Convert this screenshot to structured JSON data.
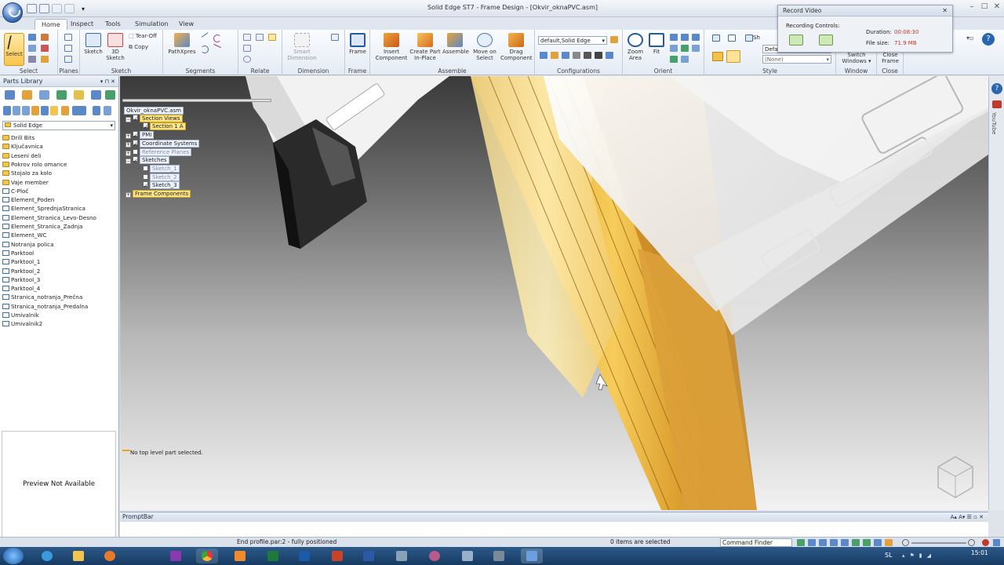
{
  "window": {
    "title": "Solid Edge ST7 - Frame Design - [Okvir_oknaPVC.asm]",
    "min": "–",
    "max": "□",
    "close": "✕"
  },
  "tabs": [
    "Home",
    "Inspect",
    "Tools",
    "Simulation",
    "View"
  ],
  "ribbon": {
    "groups": {
      "select": "Select",
      "planes": "Planes",
      "sketch": "Sketch",
      "segments": "Segments",
      "relate": "Relate",
      "dimension": "Dimension",
      "frame": "Frame",
      "assemble": "Assemble",
      "configurations": "Configurations",
      "orient": "Orient",
      "style": "Style",
      "window": "Window",
      "close": "Close"
    },
    "buttons": {
      "select": "Select",
      "sketch": "Sketch",
      "sketch3d_1": "3D",
      "sketch3d_2": "Sketch",
      "tearoff": "Tear-Off",
      "copy": "Copy",
      "pathxpres": "PathXpres",
      "smart_dim_1": "Smart",
      "smart_dim_2": "Dimension",
      "frame": "Frame",
      "insert_1": "Insert",
      "insert_2": "Component",
      "create_1": "Create Part",
      "create_2": "In-Place",
      "assemble": "Assemble",
      "move_1": "Move on",
      "move_2": "Select",
      "drag_1": "Drag",
      "drag_2": "Component",
      "zoom_1": "Zoom",
      "zoom_2": "Area",
      "fit": "Fit",
      "switch_1": "Switch",
      "switch_2": "Windows ▾",
      "closeframe_1": "Close",
      "closeframe_2": "Frame"
    },
    "configurations_value": "default,Solid Edge",
    "style_value": "(None)",
    "style_top": "Defa",
    "style_sh": "Sh"
  },
  "record_video": {
    "title": "Record Video",
    "recording_label": "Recording Controls:",
    "duration_label": "Duration:",
    "duration_value": "00:08:30",
    "filesize_label": "File size:",
    "filesize_value": "71.9 MB",
    "close": "✕"
  },
  "parts_library": {
    "title": "Parts Library",
    "location": "Solid Edge",
    "items": [
      {
        "name": "Drill Bits",
        "type": "folder"
      },
      {
        "name": "Ključavnica",
        "type": "folder"
      },
      {
        "name": "Leseni deli",
        "type": "folder"
      },
      {
        "name": "Pokrov rolo omarice",
        "type": "folder"
      },
      {
        "name": "Stojalo za kolo",
        "type": "folder"
      },
      {
        "name": "Vaje member",
        "type": "folder"
      },
      {
        "name": "C-Ploč",
        "type": "doc"
      },
      {
        "name": "Element_Poden",
        "type": "doc"
      },
      {
        "name": "Element_SprednjaStranica",
        "type": "doc"
      },
      {
        "name": "Element_Stranica_Levo-Desno",
        "type": "doc"
      },
      {
        "name": "Element_Stranica_Zadnja",
        "type": "doc"
      },
      {
        "name": "Element_WC",
        "type": "doc"
      },
      {
        "name": "Notranja polica",
        "type": "doc"
      },
      {
        "name": "Parktool",
        "type": "doc"
      },
      {
        "name": "Parktool_1",
        "type": "doc"
      },
      {
        "name": "Parktool_2",
        "type": "doc"
      },
      {
        "name": "Parktool_3",
        "type": "doc"
      },
      {
        "name": "Parktool_4",
        "type": "doc"
      },
      {
        "name": "Stranica_notranja_Prečna",
        "type": "doc"
      },
      {
        "name": "Stranica_notranja_Predalna",
        "type": "doc"
      },
      {
        "name": "Umivalnik",
        "type": "doc"
      },
      {
        "name": "Umivalnik2",
        "type": "doc"
      }
    ],
    "preview_text": "Preview Not Available"
  },
  "pathfinder": {
    "root": "Okvir_oknaPVC.asm",
    "section_views": "Section Views",
    "section_1a": "Section 1 A",
    "pmi": "PMI",
    "coord_systems": "Coordinate Systems",
    "ref_planes": "Reference Planes",
    "sketches": "Sketches",
    "sketch_1": "Sketch_1",
    "sketch_2": "Sketch_2",
    "sketch_3": "Sketch_3",
    "frame_components": "Frame Components",
    "status": "No top level part selected."
  },
  "promptbar": {
    "title": "PromptBar",
    "controls": "A▴ A▾ ☰ ▫ ✕"
  },
  "statusbar": {
    "message": "End profile.par:2 - fully positioned",
    "selection": "0 items are selected",
    "command_finder": "Command Finder"
  },
  "taskbar": {
    "lang": "SL",
    "time": "15:01"
  },
  "colors": {
    "accent_orange": "#f0a21c",
    "ribbon_bg": "#e4ebf4",
    "record_red": "#c0392b"
  }
}
